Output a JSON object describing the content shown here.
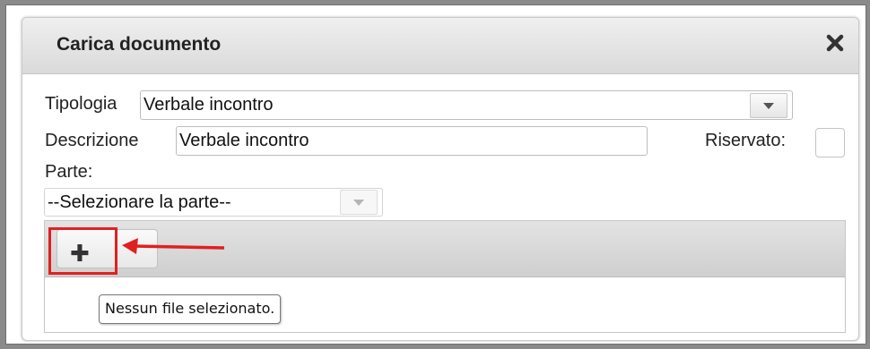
{
  "dialog": {
    "title": "Carica documento",
    "close_icon": "close-x-icon"
  },
  "form": {
    "tipologia_label": "Tipologia",
    "tipologia_value": "Verbale incontro",
    "descrizione_label": "Descrizione",
    "descrizione_value": "Verbale incontro",
    "riservato_label": "Riservato:",
    "riservato_checked": false,
    "parte_label": "Parte:",
    "parte_value": "--Selezionare la parte--"
  },
  "upload": {
    "add_button_icon": "plus-icon",
    "tooltip": "Nessun file selezionato."
  },
  "annotation": {
    "highlight_color": "#e02020"
  }
}
